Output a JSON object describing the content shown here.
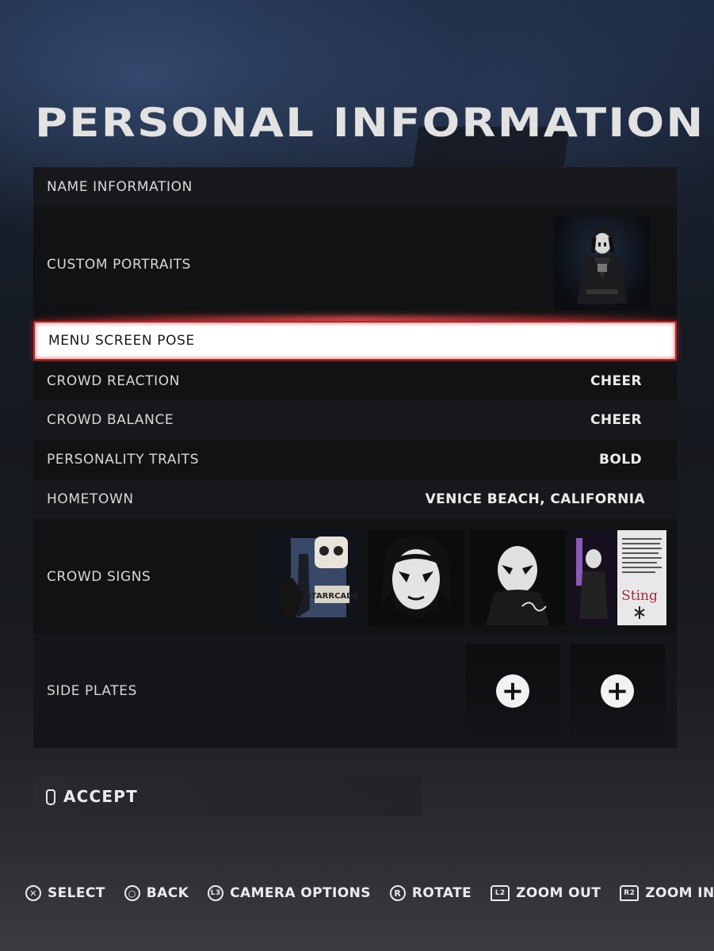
{
  "screen": {
    "title": "PERSONAL INFORMATION"
  },
  "menu": {
    "rows": [
      {
        "label": "NAME INFORMATION",
        "value": ""
      },
      {
        "label": "CUSTOM PORTRAITS",
        "value": ""
      },
      {
        "label": "MENU SCREEN POSE",
        "value": "",
        "selected": true
      },
      {
        "label": "CROWD REACTION",
        "value": "CHEER"
      },
      {
        "label": "CROWD BALANCE",
        "value": "CHEER"
      },
      {
        "label": "PERSONALITY TRAITS",
        "value": "BOLD"
      },
      {
        "label": "HOMETOWN",
        "value": "VENICE BEACH, CALIFORNIA"
      },
      {
        "label": "CROWD SIGNS",
        "value": ""
      },
      {
        "label": "SIDE PLATES",
        "value": ""
      }
    ],
    "crowd_sign_texts": [
      "STARRCADE",
      "Sting"
    ]
  },
  "accept_label": "ACCEPT",
  "footer": {
    "items": [
      {
        "icon": "cross-button-icon",
        "glyph": "✕",
        "label": "SELECT"
      },
      {
        "icon": "circle-button-icon",
        "glyph": "○",
        "label": "BACK"
      },
      {
        "icon": "l3-button-icon",
        "glyph": "L3",
        "label": "CAMERA OPTIONS"
      },
      {
        "icon": "r-stick-icon",
        "glyph": "R",
        "label": "ROTATE"
      },
      {
        "icon": "l2-button-icon",
        "glyph": "L2",
        "label": "ZOOM OUT"
      },
      {
        "icon": "r2-button-icon",
        "glyph": "R2",
        "label": "ZOOM IN"
      }
    ]
  },
  "colors": {
    "accent": "#b8262a",
    "panel": "#111214",
    "panel_alt": "#17181b",
    "selected_bg": "#ffffff"
  }
}
